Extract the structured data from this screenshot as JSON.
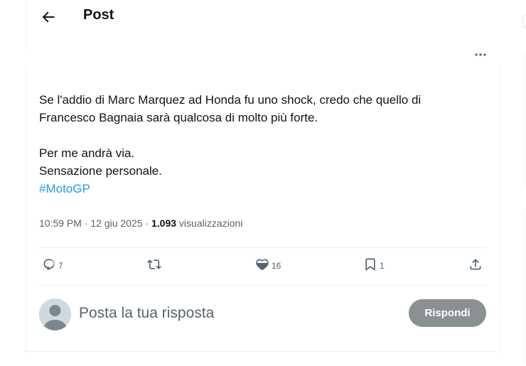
{
  "header": {
    "title": "Post"
  },
  "post": {
    "text": "Se l'addio di Marc Marquez ad Honda fu uno shock, credo che quello di\nFrancesco Bagnaia sarà qualcosa di molto più forte.\n\nPer me andrà via.\nSensazione personale.",
    "hashtag": "#MotoGP",
    "timestamp": "10:59 PM · 12 giu 2025 · ",
    "views_count": "1.093",
    "views_label": " visualizzazioni"
  },
  "actions": {
    "replies": "7",
    "retweets": "",
    "likes": "16",
    "bookmarks": "1"
  },
  "reply": {
    "placeholder": "Posta la tua risposta",
    "button_label": "Rispondi"
  },
  "icons": [
    "back-arrow-icon",
    "more-icon",
    "reply-icon",
    "retweet-icon",
    "like-icon",
    "bookmark-icon",
    "share-icon",
    "avatar"
  ],
  "colors": {
    "accent": "#1d9bf0",
    "muted": "#536471",
    "reply_button": "#8b9093"
  }
}
